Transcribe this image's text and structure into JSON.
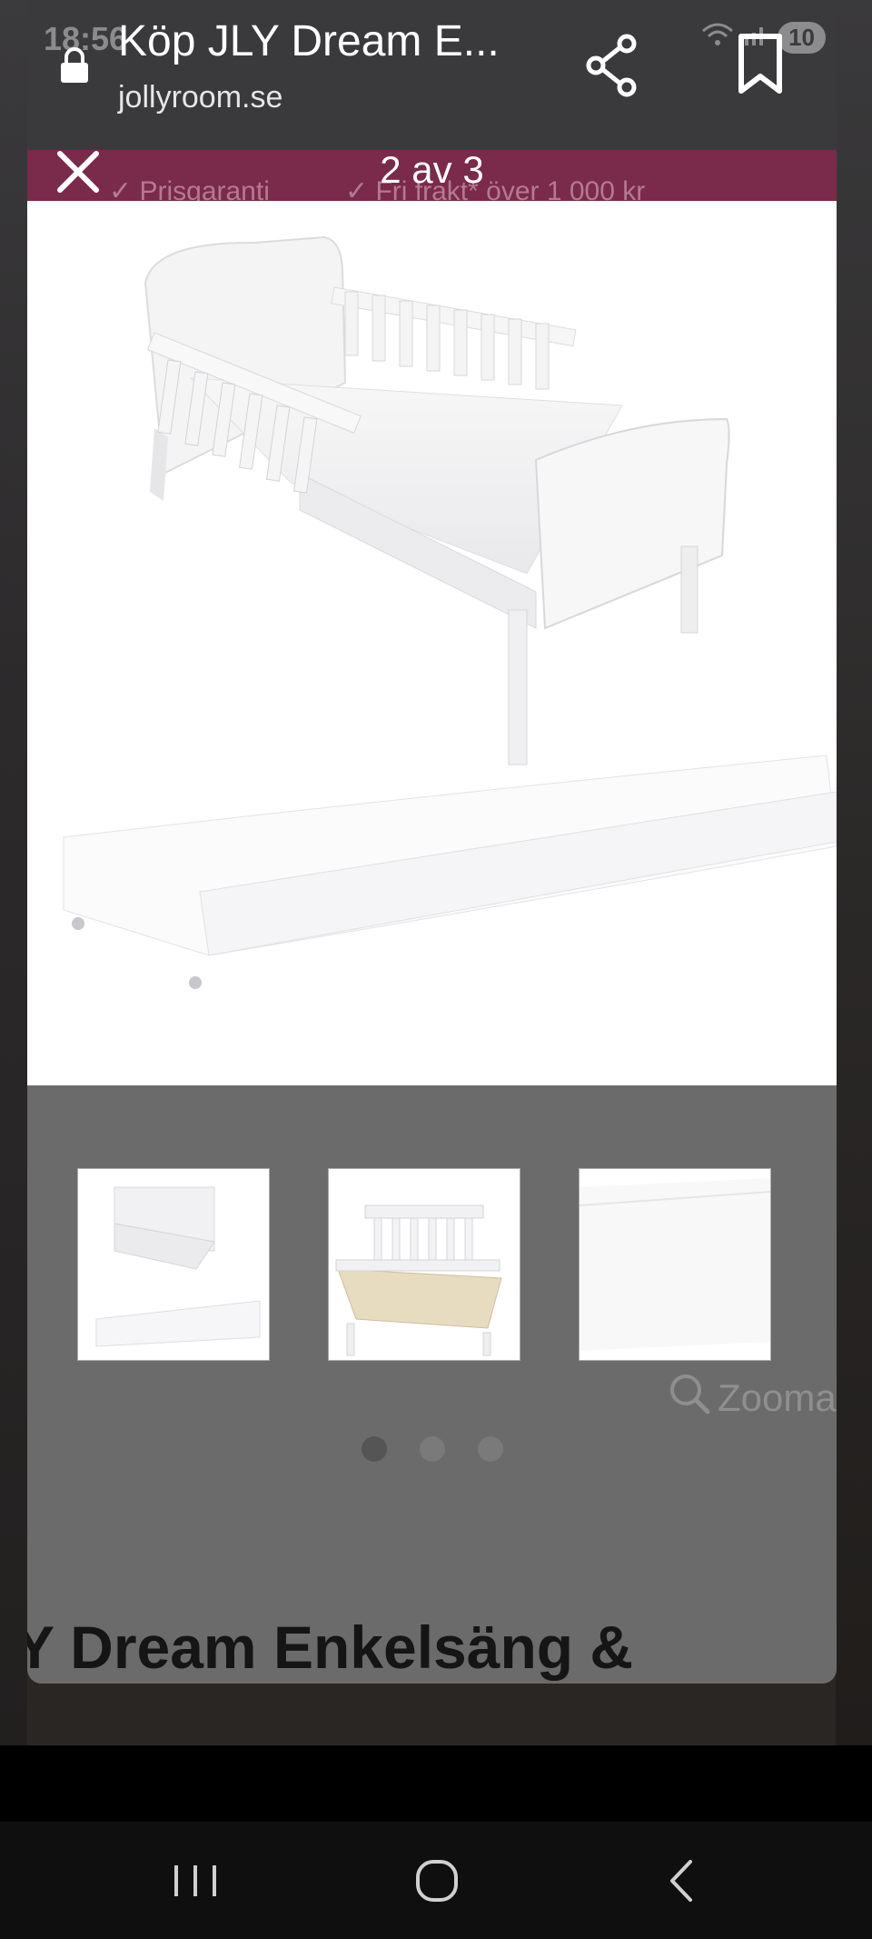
{
  "status": {
    "time": "18:56",
    "badge": "10"
  },
  "browser": {
    "title": "Köp JLY Dream E...",
    "domain": "jollyroom.se"
  },
  "promo": {
    "item_1": "✓ Prisgaranti",
    "item_2": "✓ Fri frakt* över 1 000 kr"
  },
  "viewer": {
    "counter": "2 av 3"
  },
  "gallery": {
    "zoom_label": "Zooma",
    "thumbnails": [
      "bed-with-drawer",
      "bed-slats",
      "drawer"
    ],
    "active_dot": 0
  },
  "product": {
    "heading": "Y Dream Enkelsäng &"
  },
  "colors": {
    "promo_bar": "#7a2a4a",
    "topbar": "#3a3a3d"
  },
  "icons": [
    "lock-icon",
    "share-icon",
    "bookmark-icon",
    "close-icon",
    "search-icon",
    "recents-icon",
    "home-icon",
    "back-icon"
  ]
}
